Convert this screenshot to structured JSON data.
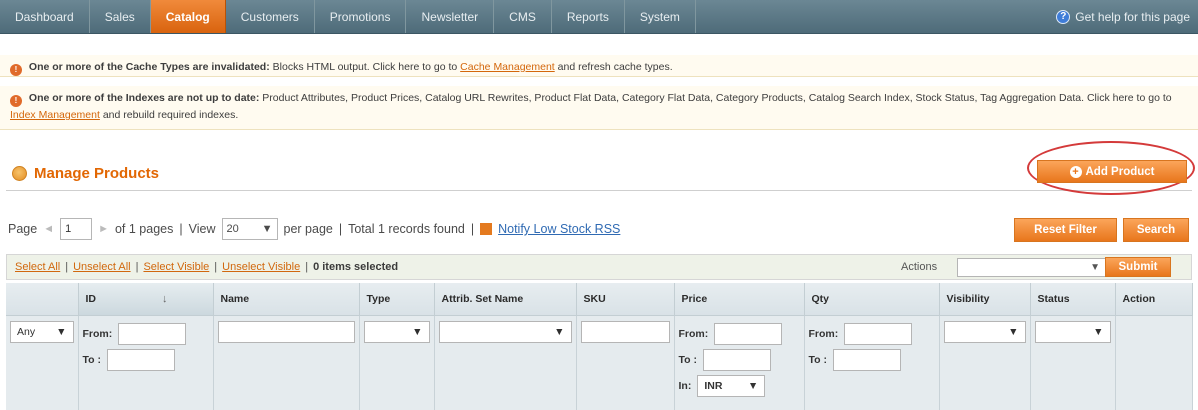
{
  "nav": {
    "items": [
      "Dashboard",
      "Sales",
      "Catalog",
      "Customers",
      "Promotions",
      "Newsletter",
      "CMS",
      "Reports",
      "System"
    ],
    "active": "Catalog",
    "help": "Get help for this page"
  },
  "notices": {
    "cache": {
      "bold": "One or more of the Cache Types are invalidated:",
      "text": "Blocks HTML output. Click here to go to",
      "link": "Cache Management",
      "tail": "and refresh cache types."
    },
    "index": {
      "bold": "One or more of the Indexes are not up to date:",
      "text": "Product Attributes, Product Prices, Catalog URL Rewrites, Product Flat Data, Category Flat Data, Category Products, Catalog Search Index, Stock Status, Tag Aggregation Data. Click here to go to",
      "link": "Index Management",
      "tail": "and rebuild required indexes."
    }
  },
  "page": {
    "title": "Manage Products",
    "add_button": "Add Product"
  },
  "pager": {
    "page_label": "Page",
    "page_value": "1",
    "of_pages": "of 1 pages",
    "view_label": "View",
    "view_value": "20",
    "per_page": "per page",
    "records": "Total 1 records found",
    "rss_link": "Notify Low Stock RSS",
    "reset_button": "Reset Filter",
    "search_button": "Search"
  },
  "massaction": {
    "select_all": "Select All",
    "unselect_all": "Unselect All",
    "select_visible": "Select Visible",
    "unselect_visible": "Unselect Visible",
    "selected": "0 items selected",
    "actions_label": "Actions",
    "submit": "Submit"
  },
  "grid": {
    "columns": [
      "ID",
      "Name",
      "Type",
      "Attrib. Set Name",
      "SKU",
      "Price",
      "Qty",
      "Visibility",
      "Status",
      "Action"
    ],
    "filters": {
      "massaction_select": "Any",
      "from_label": "From:",
      "to_label": "To :",
      "in_label": "In:",
      "currency": "INR"
    }
  }
}
